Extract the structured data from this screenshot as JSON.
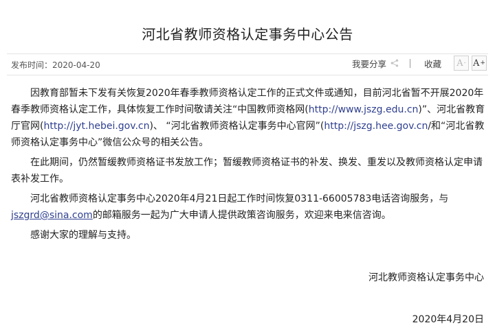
{
  "title": "河北省教师资格认定事务中心公告",
  "meta": {
    "published_label": "发布时间：",
    "published_date": "2020-04-20",
    "share_label": "我要分享",
    "favorite_label": "收藏",
    "font_smaller": "A",
    "font_smaller_sup": "-",
    "font_larger": "A",
    "font_larger_sup": "+"
  },
  "body": {
    "p1": {
      "t1": "因教育部暂未下发有关恢复2020年春季教师资格认定工作的正式文件或通知，目前河北省暂不开展2020年春季教师资格认定工作，具体恢复工作时间敬请关注“中国教师资格网(",
      "link1": "http://www.jszg.edu.cn",
      "t2": ")”、河北省教育厅官网(",
      "link2": "http://jyt.hebei.gov.cn",
      "t3": ")、 “河北省教师资格认定事务中心官网”(",
      "link3": "http://jszg.hee.gov.cn",
      "t4": "/和“河北省教师资格认定事务中心”微信公众号的相关公告。"
    },
    "p2": "在此期间，仍然暂缓教师资格证书发放工作；暂缓教师资格证书的补发、换发、重发以及教师资格认定申请表补发工作。",
    "p3": {
      "t1": "河北省教师资格认定事务中心2020年4月21日起工作时间恢复0311-66005783电话咨询服务，与",
      "email": "jszgrd@sina.com",
      "t2": "的邮箱服务一起为广大申请人提供政策咨询服务，欢迎来电来信咨询。"
    },
    "p4": "感谢大家的理解与支持。"
  },
  "signature": "河北教师资格认定事务中心",
  "date": "2020年4月20日"
}
